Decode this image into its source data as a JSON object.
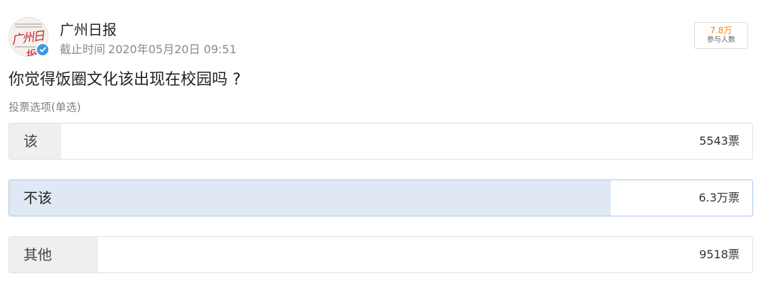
{
  "header": {
    "account_name": "广州日报",
    "avatar_logo_text": "广州日报",
    "deadline_label": "截止时间",
    "deadline_time": "2020年05月20日 09:51",
    "participants_count": "7.8万",
    "participants_label": "参与人数"
  },
  "poll": {
    "question": "你觉得饭圈文化该出现在校园吗 ?",
    "vote_type": "投票选项(单选)",
    "options": [
      {
        "label": "该",
        "votes": "5543票",
        "selected": false,
        "fill_fraction": 0.07
      },
      {
        "label": "不该",
        "votes": "6.3万票",
        "selected": true,
        "fill_fraction": 0.81
      },
      {
        "label": "其他",
        "votes": "9518票",
        "selected": false,
        "fill_fraction": 0.12
      }
    ]
  },
  "colors": {
    "accent_orange": "#ff8200",
    "verified_blue": "#3f98e6",
    "selected_fill": "#dfe8f3",
    "selected_border": "#a9c8ea",
    "unselected_fill": "#efefef"
  }
}
